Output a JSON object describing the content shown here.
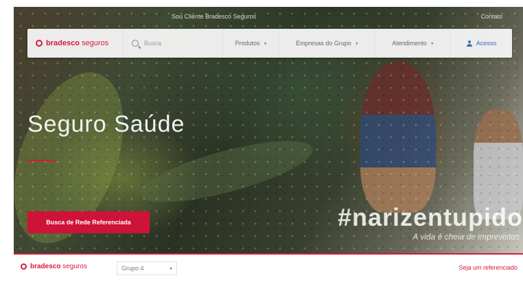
{
  "topbar": {
    "links": "Sou Cliente Bradesco Seguros",
    "right": "Contato"
  },
  "brand": {
    "name_bold": "bradesco",
    "name_light": "seguros"
  },
  "nav": {
    "search_placeholder": "Busca",
    "items": [
      {
        "label": "Produtos",
        "chevron": "▾"
      },
      {
        "label": "Empresas do Grupo",
        "chevron": "▾"
      },
      {
        "label": "Atendimento",
        "chevron": "▾"
      }
    ],
    "access_label": "Acesso"
  },
  "hero": {
    "title": "Seguro Saúde",
    "cta_label": "Busca de Rede Referenciada",
    "hashtag": "#narizentupido",
    "tagline": "A vida é cheia de imprevistos"
  },
  "footer": {
    "selector_value": "Grupo 4",
    "selector_chevron": "▾",
    "link_label": "Seja um referenciado"
  },
  "colors": {
    "brand_red": "#d8183c",
    "cta_red": "#cf1238",
    "access_blue": "#3a6fb7"
  }
}
